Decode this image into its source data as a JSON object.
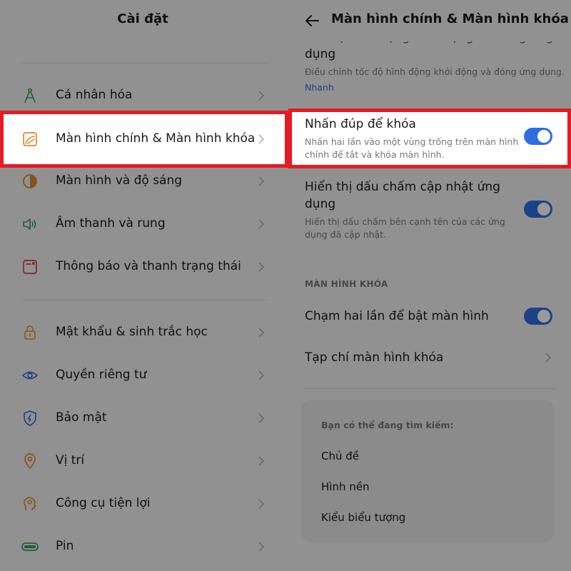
{
  "left": {
    "title": "Cài đặt",
    "items": [
      {
        "label": "Cá nhân hóa",
        "icon": "personalization-icon"
      },
      {
        "label": "Màn hình chính & Màn hình khóa",
        "icon": "home-lock-screen-icon",
        "highlighted": true
      },
      {
        "label": "Màn hình và độ sáng",
        "icon": "brightness-icon"
      },
      {
        "label": "Âm thanh và rung",
        "icon": "speaker-icon"
      },
      {
        "label": "Thông báo và thanh trạng thái",
        "icon": "notification-icon"
      },
      {
        "label": "Mật khẩu & sinh trắc học",
        "icon": "lock-icon"
      },
      {
        "label": "Quyền riêng tư",
        "icon": "privacy-eye-icon"
      },
      {
        "label": "Bảo mật",
        "icon": "shield-icon"
      },
      {
        "label": "Vị trí",
        "icon": "location-pin-icon"
      },
      {
        "label": "Công cụ tiện lợi",
        "icon": "tools-icon"
      },
      {
        "label": "Pin",
        "icon": "battery-icon"
      }
    ]
  },
  "right": {
    "title": "Màn hình chính & Màn hình khóa",
    "top_cut_text": "Tốc độ hình động khởi động và đóng ứng",
    "top_title_line2": "dụng",
    "top_desc": "Điều chỉnh tốc độ hình động khởi động và đóng ứng dụng.",
    "top_value": "Nhanh",
    "double_tap_lock": {
      "title": "Nhấn đúp để khóa",
      "desc_line1": "Nhấn hai lần vào một vùng trống trên màn hình",
      "desc_line2": "chính để tắt và khóa màn hình.",
      "enabled": true
    },
    "update_dot": {
      "title_line1": "Hiển thị dấu chấm cập nhật ứng",
      "title_line2": "dụng",
      "desc_line1": "Hiển thị dấu chấm bên cạnh tên của các ứng",
      "desc_line2": "dụng đã cập nhật.",
      "enabled": true
    },
    "lock_section_label": "MÀN HÌNH KHÓA",
    "double_tap_wake": {
      "title": "Chạm hai lần để bật màn hình",
      "enabled": true
    },
    "lock_magazine": {
      "title": "Tạp chí màn hình khóa"
    },
    "search": {
      "heading": "Bạn có thể đang tìm kiếm:",
      "items": [
        "Chủ đề",
        "Hình nền",
        "Kiểu biểu tượng"
      ]
    }
  },
  "colors": {
    "highlight_border": "#e41b23",
    "toggle_on": "#2f6de1"
  }
}
